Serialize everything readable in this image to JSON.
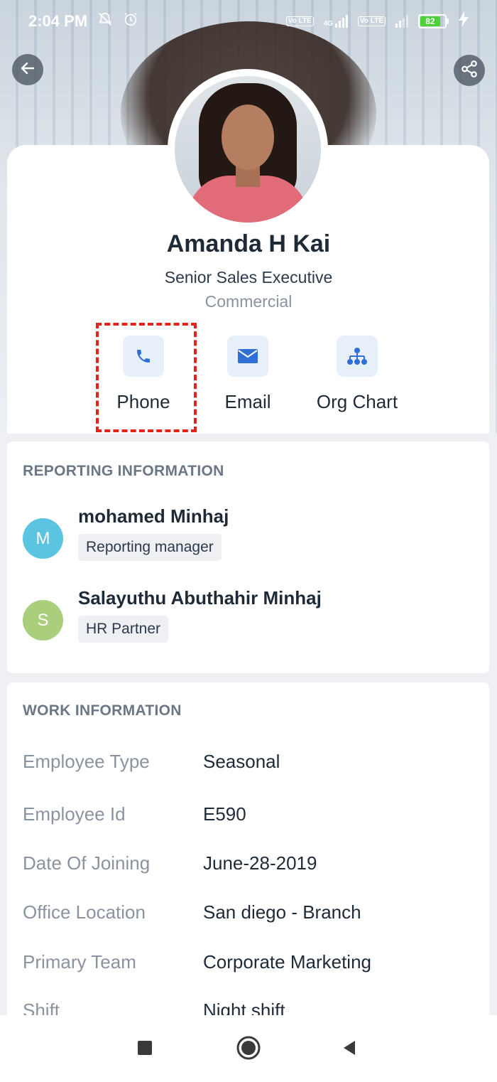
{
  "status_bar": {
    "time": "2:04 PM",
    "net_badge_1": "Vo LTE",
    "net_badge_2": "Vo LTE",
    "network_type": "4G",
    "battery_level": "82"
  },
  "profile": {
    "name": "Amanda H Kai",
    "title": "Senior Sales Executive",
    "department": "Commercial"
  },
  "actions": {
    "phone_label": "Phone",
    "email_label": "Email",
    "org_chart_label": "Org Chart"
  },
  "reporting": {
    "section_title": "REPORTING INFORMATION",
    "people": [
      {
        "initial": "M",
        "name": "mohamed Minhaj",
        "role": "Reporting manager",
        "color": "#5bc4e0"
      },
      {
        "initial": "S",
        "name": "Salayuthu Abuthahir Minhaj",
        "role": "HR Partner",
        "color": "#a9cf7c"
      }
    ]
  },
  "work": {
    "section_title": "WORK INFORMATION",
    "rows": [
      {
        "label": "Employee Type",
        "value": "Seasonal"
      },
      {
        "label": "Employee Id",
        "value": "E590"
      },
      {
        "label": "Date Of Joining",
        "value": "June-28-2019"
      },
      {
        "label": "Office Location",
        "value": "San diego - Branch"
      },
      {
        "label": "Primary Team",
        "value": "Corporate Marketing"
      },
      {
        "label": "Shift",
        "value": "Night shift"
      }
    ]
  },
  "colors": {
    "accent_blue": "#2f6fd6",
    "highlight_red": "#e2231a",
    "icon_bg": "#e6effa"
  },
  "icons": {
    "back": "arrow-left-icon",
    "share": "share-icon",
    "phone": "phone-icon",
    "email": "mail-icon",
    "org_chart": "org-chart-icon"
  }
}
